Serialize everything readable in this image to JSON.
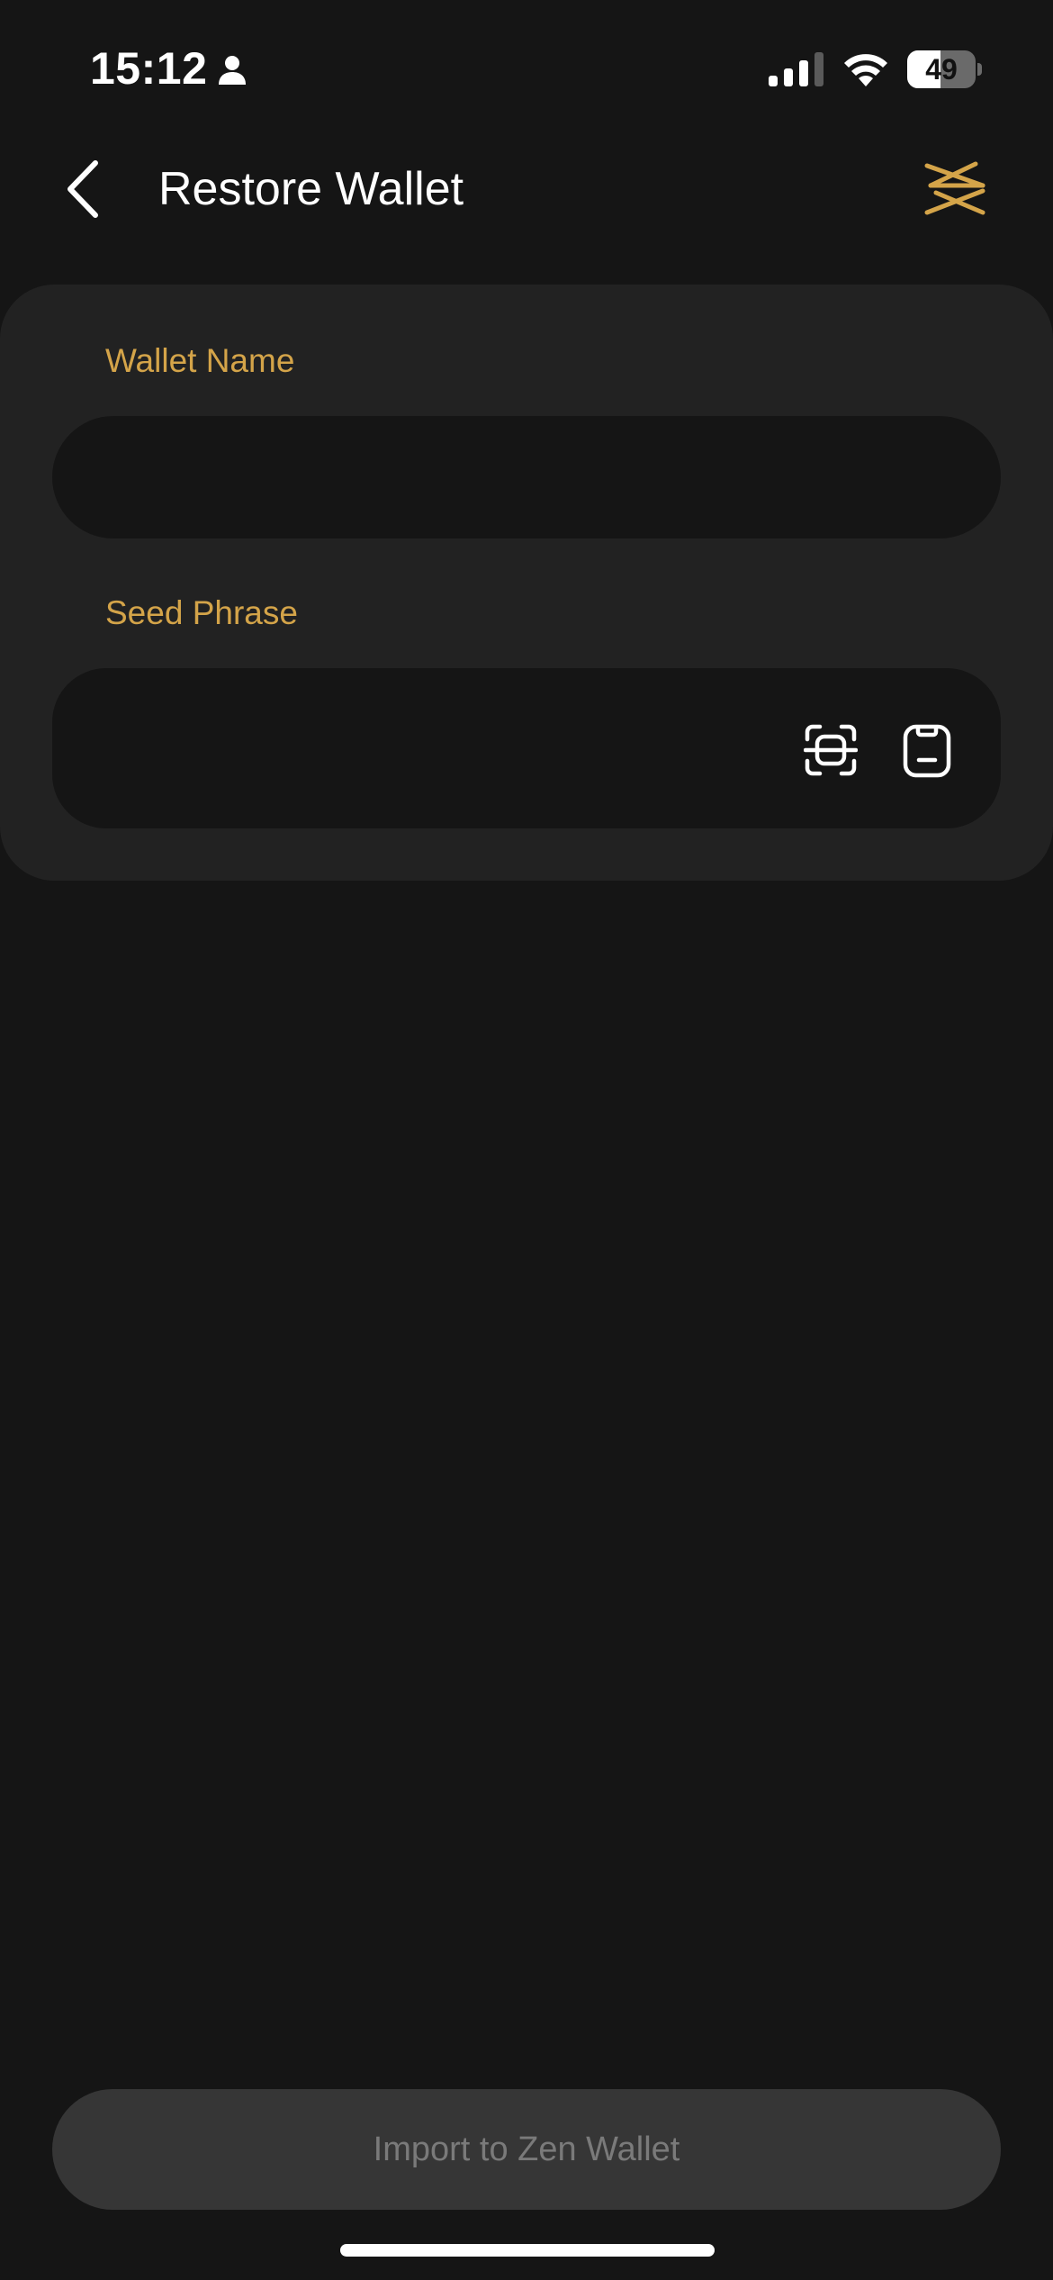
{
  "status_bar": {
    "time": "15:12",
    "battery_level": "49",
    "battery_fraction": 0.49,
    "signal_icon": "cellular-signal-icon",
    "wifi_icon": "wifi-icon",
    "person_icon": "person-icon"
  },
  "header": {
    "title": "Restore Wallet",
    "back_icon": "chevron-left-icon",
    "logo_icon": "zen-logo-icon"
  },
  "form": {
    "wallet_name": {
      "label": "Wallet Name",
      "value": "",
      "placeholder": ""
    },
    "seed_phrase": {
      "label": "Seed Phrase",
      "value": "",
      "placeholder": "",
      "scan_icon": "scan-qr-icon",
      "paste_icon": "clipboard-icon"
    }
  },
  "actions": {
    "import_label": "Import to Zen Wallet",
    "import_enabled": false
  },
  "colors": {
    "background": "#151515",
    "card": "#222222",
    "input": "#151515",
    "accent": "#d4a449",
    "button_disabled": "#363636",
    "button_text_disabled": "#7a7a7a"
  }
}
